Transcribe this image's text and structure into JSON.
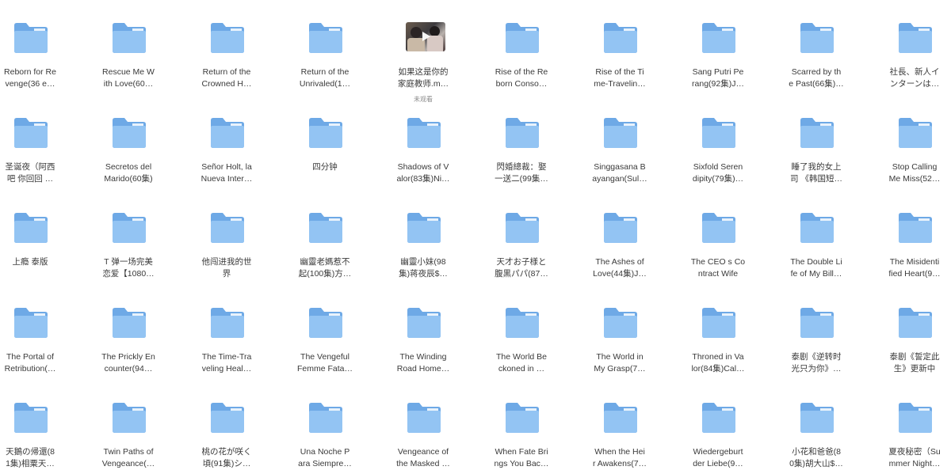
{
  "folders": [
    {
      "name": "Reborn for Re\nvenge(36 e…",
      "type": "folder"
    },
    {
      "name": "Rescue Me W\nith Love(60…",
      "type": "folder"
    },
    {
      "name": "Return of the\nCrowned H…",
      "type": "folder"
    },
    {
      "name": "Return of the\nUnrivaled(1…",
      "type": "folder"
    },
    {
      "name": "如果这是你的\n家庭教师.m…",
      "type": "video",
      "sub": "未观看"
    },
    {
      "name": "Rise of the Re\nborn Conso…",
      "type": "folder"
    },
    {
      "name": "Rise of the Ti\nme-Travelin…",
      "type": "folder"
    },
    {
      "name": "Sang Putri Pe\nrang(92集)J…",
      "type": "folder"
    },
    {
      "name": "Scarred by th\ne Past(66集)…",
      "type": "folder"
    },
    {
      "name": "社長、新人イ\nンターンは…",
      "type": "folder"
    },
    {
      "name": "圣诞夜（阿西\n吧 你回回 …",
      "type": "folder"
    },
    {
      "name": "Secretos del\nMarido(60集)",
      "type": "folder"
    },
    {
      "name": "Señor Holt, la\nNueva Inter…",
      "type": "folder"
    },
    {
      "name": "四分钟",
      "type": "folder"
    },
    {
      "name": "Shadows of V\nalor(83集)Ni…",
      "type": "folder"
    },
    {
      "name": "閃婚總裁：娶\n一送二(99集…",
      "type": "folder"
    },
    {
      "name": "Singgasana B\nayangan(Sul…",
      "type": "folder"
    },
    {
      "name": "Sixfold Seren\ndipity(79集)…",
      "type": "folder"
    },
    {
      "name": "睡了我的女上\n司 《韩国短…",
      "type": "folder"
    },
    {
      "name": "Stop Calling\nMe Miss(52…",
      "type": "folder"
    },
    {
      "name": "上瘾 泰版",
      "type": "folder"
    },
    {
      "name": "T 弹一场完美\n恋爱【1080…",
      "type": "folder"
    },
    {
      "name": "他闯进我的世\n界",
      "type": "folder"
    },
    {
      "name": "幽靈老媽惹不\n起(100集)方…",
      "type": "folder"
    },
    {
      "name": "幽靈小妹(98\n集)蒋夜辰$…",
      "type": "folder"
    },
    {
      "name": "天才お子様と\n腹黒パパ(87…",
      "type": "folder"
    },
    {
      "name": "The Ashes of\nLove(44集)J…",
      "type": "folder"
    },
    {
      "name": "The CEO s Co\nntract Wife",
      "type": "folder"
    },
    {
      "name": "The Double Li\nfe of My Bill…",
      "type": "folder"
    },
    {
      "name": "The Misidenti\nfied Heart(9…",
      "type": "folder"
    },
    {
      "name": "The Portal of\nRetribution(…",
      "type": "folder"
    },
    {
      "name": "The Prickly En\ncounter(94…",
      "type": "folder"
    },
    {
      "name": "The Time-Tra\nveling Heal…",
      "type": "folder"
    },
    {
      "name": "The Vengeful\nFemme Fata…",
      "type": "folder"
    },
    {
      "name": "The Winding\nRoad Home…",
      "type": "folder"
    },
    {
      "name": "The World Be\nckoned in …",
      "type": "folder"
    },
    {
      "name": "The World in\nMy Grasp(7…",
      "type": "folder"
    },
    {
      "name": "Throned in Va\nlor(84集)Cal…",
      "type": "folder"
    },
    {
      "name": "泰剧《逆转时\n光只为你》…",
      "type": "folder"
    },
    {
      "name": "泰剧《誓定此\n生》更新中",
      "type": "folder"
    },
    {
      "name": "天鵝の帰還(8\n1集)相粟天…",
      "type": "folder"
    },
    {
      "name": "Twin Paths of\nVengeance(…",
      "type": "folder"
    },
    {
      "name": "桃の花が咲く\n頃(91集)シ…",
      "type": "folder"
    },
    {
      "name": "Una Noche P\nara Siempre…",
      "type": "folder"
    },
    {
      "name": "Vengeance of\nthe Masked …",
      "type": "folder"
    },
    {
      "name": "When Fate Bri\nngs You Bac…",
      "type": "folder"
    },
    {
      "name": "When the Hei\nr Awakens(7…",
      "type": "folder"
    },
    {
      "name": "Wiedergeburt\nder Liebe(9…",
      "type": "folder"
    },
    {
      "name": "小花和爸爸(8\n0集)胡大山$…",
      "type": "folder"
    },
    {
      "name": "夏夜秘密（Su\nmmer Night…",
      "type": "folder"
    }
  ],
  "colors": {
    "folder_back": "#6ea9e6",
    "folder_front": "#93c4f3",
    "folder_sheet": "#e8f2fc"
  },
  "icons": {
    "folder": "folder-icon",
    "video": "video-thumbnail"
  }
}
